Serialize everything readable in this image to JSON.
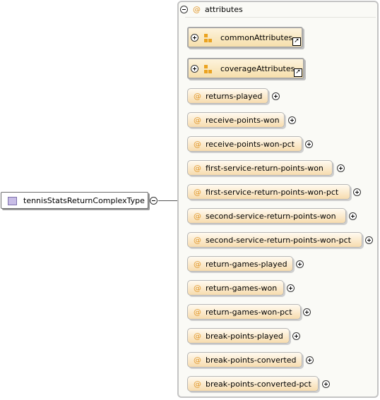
{
  "complex_type": {
    "name": "tennisStatsReturnComplexType"
  },
  "attributes_group": {
    "at_symbol": "@",
    "title": "attributes"
  },
  "group_refs": [
    {
      "label": "commonAttributes"
    },
    {
      "label": "coverageAttributes"
    }
  ],
  "attributes": [
    {
      "label": "returns-played"
    },
    {
      "label": "receive-points-won"
    },
    {
      "label": "receive-points-won-pct"
    },
    {
      "label": "first-service-return-points-won"
    },
    {
      "label": "first-service-return-points-won-pct"
    },
    {
      "label": "second-service-return-points-won"
    },
    {
      "label": "second-service-return-points-won-pct"
    },
    {
      "label": "return-games-played"
    },
    {
      "label": "return-games-won"
    },
    {
      "label": "return-games-won-pct"
    },
    {
      "label": "break-points-played"
    },
    {
      "label": "break-points-converted"
    },
    {
      "label": "break-points-converted-pct"
    }
  ],
  "colors": {
    "at_symbol": "#e1982c",
    "type_icon": "#c8bde6",
    "group_icon": "#eba321"
  },
  "icons": {
    "type": "complex-type-icon",
    "group": "attribute-group-icon",
    "link": "reference-link-icon",
    "collapse": "collapse-icon",
    "expand": "expand-icon"
  }
}
